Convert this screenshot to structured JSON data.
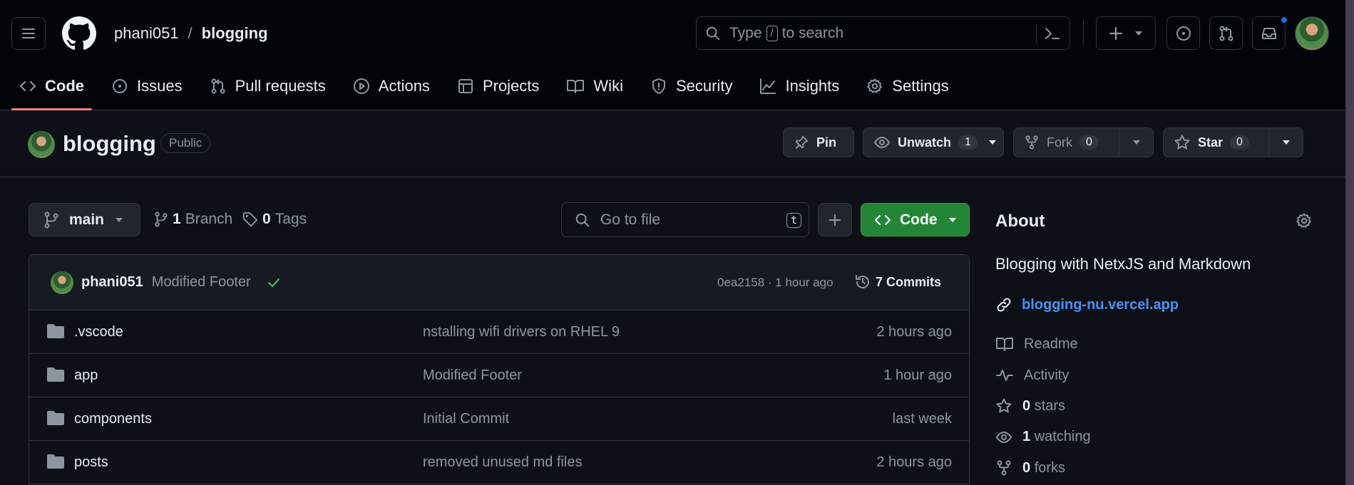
{
  "header": {
    "owner": "phani051",
    "separator": "/",
    "repo": "blogging",
    "search": {
      "prefix": "Type",
      "key": "/",
      "suffix": "to search"
    }
  },
  "tabs": [
    {
      "label": "Code",
      "icon": "code-icon",
      "selected": true
    },
    {
      "label": "Issues",
      "icon": "issue-opened-icon"
    },
    {
      "label": "Pull requests",
      "icon": "git-pull-request-icon"
    },
    {
      "label": "Actions",
      "icon": "play-icon"
    },
    {
      "label": "Projects",
      "icon": "table-icon"
    },
    {
      "label": "Wiki",
      "icon": "book-icon"
    },
    {
      "label": "Security",
      "icon": "shield-icon"
    },
    {
      "label": "Insights",
      "icon": "graph-icon"
    },
    {
      "label": "Settings",
      "icon": "gear-icon"
    }
  ],
  "repo_title": {
    "name": "blogging",
    "visibility": "Public",
    "pin": "Pin",
    "unwatch": "Unwatch",
    "watch_count": "1",
    "fork": "Fork",
    "fork_count": "0",
    "star": "Star",
    "star_count": "0"
  },
  "toolbar": {
    "branch": "main",
    "branches_count": "1",
    "branches_label": "Branch",
    "tags_count": "0",
    "tags_label": "Tags",
    "goto_placeholder": "Go to file",
    "goto_key": "t",
    "code_button": "Code"
  },
  "commit": {
    "author": "phani051",
    "message": "Modified Footer",
    "hash_time": "0ea2158 · 1 hour ago",
    "commits": "7 Commits"
  },
  "files": [
    {
      "name": ".vscode",
      "message": "nstalling wifi drivers on RHEL 9",
      "date": "2 hours ago"
    },
    {
      "name": "app",
      "message": "Modified Footer",
      "date": "1 hour ago"
    },
    {
      "name": "components",
      "message": "Initial Commit",
      "date": "last week"
    },
    {
      "name": "posts",
      "message": "removed unused md files",
      "date": "2 hours ago"
    }
  ],
  "about": {
    "title": "About",
    "description": "Blogging with NetxJS and Markdown",
    "link": "blogging-nu.vercel.app",
    "readme": "Readme",
    "activity": "Activity",
    "stars_count": "0",
    "stars_label": "stars",
    "watching_count": "1",
    "watching_label": "watching",
    "forks_count": "0",
    "forks_label": "forks"
  },
  "colors": {
    "background": "#0d1117",
    "header_bg": "#010409",
    "border": "#30363d",
    "accent_link": "#4493f8",
    "primary_button": "#238636",
    "tab_underline": "#f78166",
    "notification": "#1f6feb"
  }
}
